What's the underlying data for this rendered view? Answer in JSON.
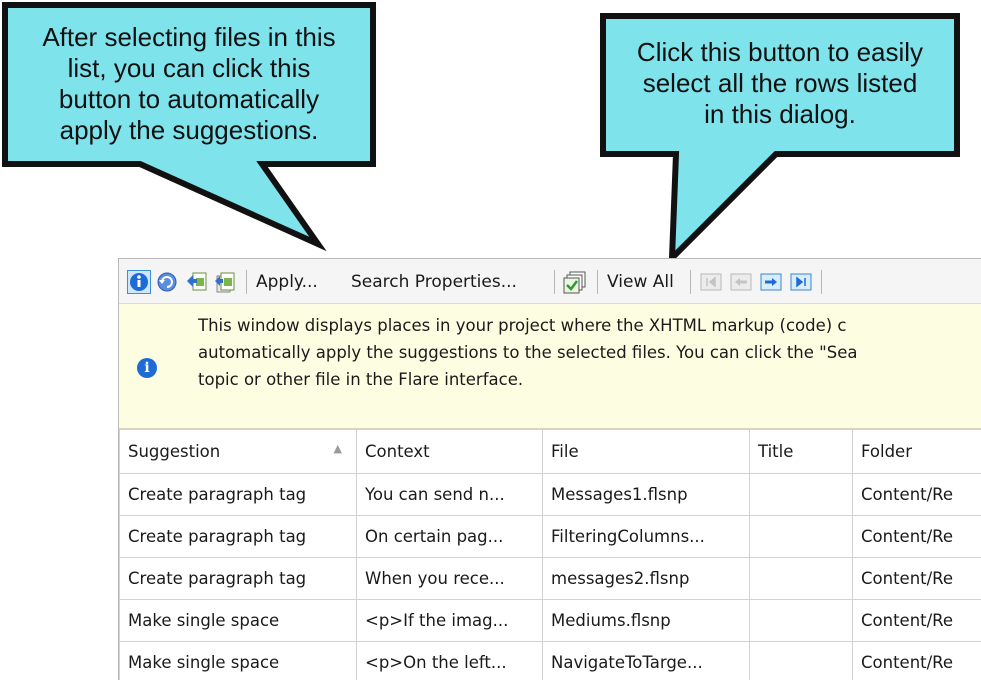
{
  "callouts": [
    {
      "lines": [
        "After selecting files in this",
        "list, you can click this",
        "button to automatically",
        "apply the suggestions."
      ]
    },
    {
      "lines": [
        "Click this button to easily",
        "select all the rows listed",
        "in this dialog."
      ]
    }
  ],
  "toolbar": {
    "apply_label": "Apply...",
    "search_properties_label": "Search Properties...",
    "view_all_label": "View All"
  },
  "info": {
    "lines": [
      "This window displays places in your project where the XHTML markup (code) c",
      "automatically apply the suggestions to the selected files. You can click the \"Sea",
      "topic or other file in the Flare interface."
    ]
  },
  "table": {
    "columns": [
      "Suggestion",
      "Context",
      "File",
      "Title",
      "Folder"
    ],
    "rows": [
      [
        "Create paragraph tag",
        "You can send n...",
        "Messages1.flsnp",
        "",
        "Content/Re"
      ],
      [
        "Create paragraph tag",
        "On certain pag...",
        "FilteringColumns...",
        "",
        "Content/Re"
      ],
      [
        "Create paragraph tag",
        "When you rece...",
        "messages2.flsnp",
        "",
        "Content/Re"
      ],
      [
        "Make single space",
        "<p>If the imag...",
        "Mediums.flsnp",
        "",
        "Content/Re"
      ],
      [
        "Make single space",
        "<p>On the left...",
        "NavigateToTarge...",
        "",
        "Content/Re"
      ]
    ]
  },
  "colors": {
    "callout_fill": "#7fe3ec",
    "callout_border": "#111111",
    "info_bg": "#fdfde2"
  }
}
